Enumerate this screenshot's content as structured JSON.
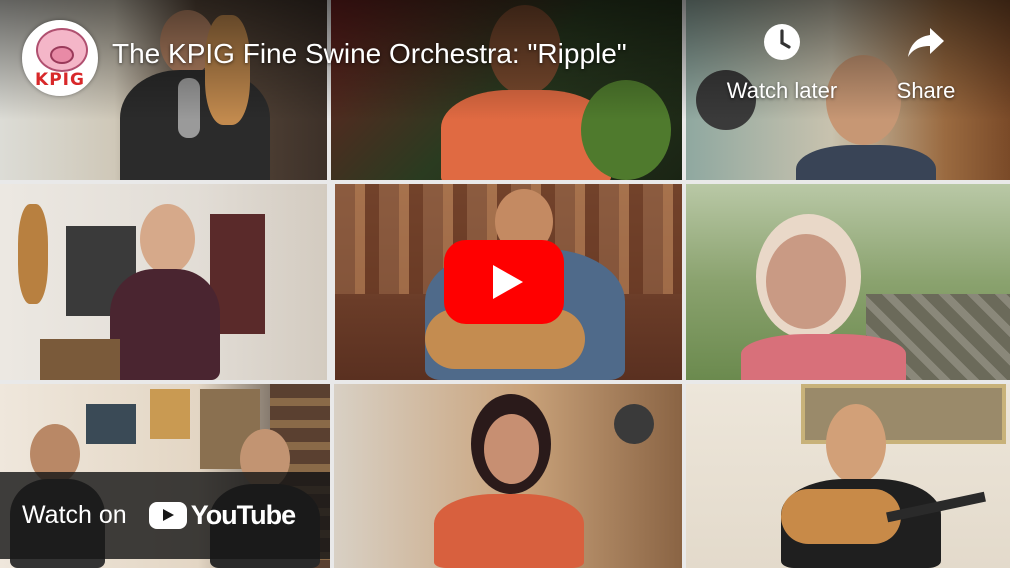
{
  "video": {
    "title": "The KPIG Fine Swine Orchestra: \"Ripple\""
  },
  "channel": {
    "logo_text": "KPIG"
  },
  "actions": {
    "watch_later_label": "Watch later",
    "share_label": "Share"
  },
  "watch_on": {
    "label": "Watch on",
    "brand": "YouTube"
  },
  "colors": {
    "play_button": "#ff0000",
    "watch_on_bar": "#171717"
  },
  "icons": {
    "watch_later": "clock-icon",
    "share": "share-arrow-icon",
    "play": "play-icon",
    "youtube": "youtube-logo-icon"
  }
}
